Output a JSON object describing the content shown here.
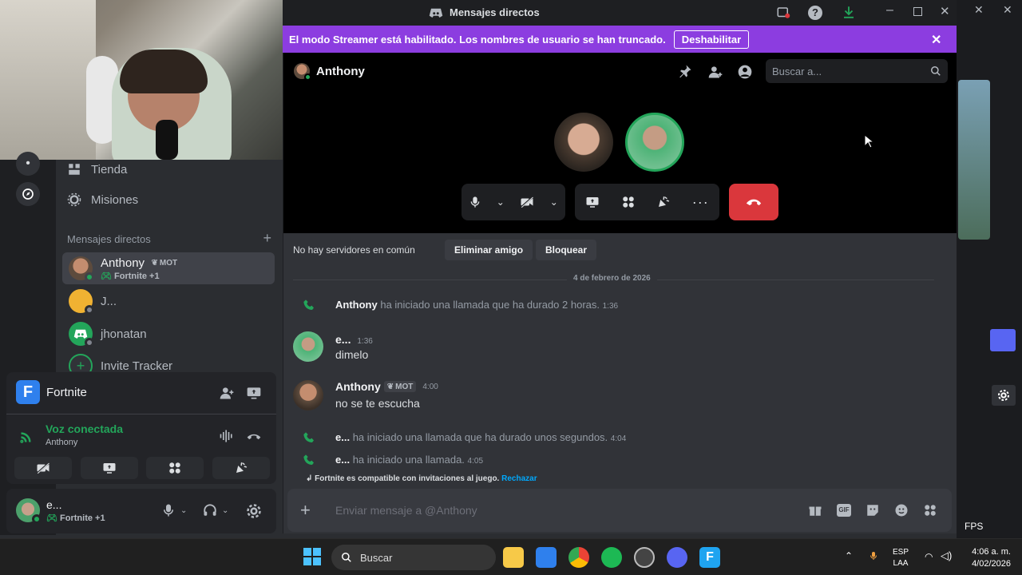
{
  "window": {
    "title": "Mensajes directos"
  },
  "streamer_banner": {
    "text": "El modo Streamer está habilitado. Los nombres de usuario se han truncado.",
    "button": "Deshabilitar"
  },
  "sidebar": {
    "nav": [
      {
        "label": "Tienda",
        "icon": "shop-icon"
      },
      {
        "label": "Misiones",
        "icon": "quests-icon"
      }
    ],
    "dm_header": "Mensajes directos",
    "dms": [
      {
        "name": "Anthony",
        "tag": "MOT",
        "activity": "Fortnite +1",
        "active": true
      },
      {
        "name": "J...",
        "activity": ""
      },
      {
        "name": "jhonatan",
        "activity": ""
      },
      {
        "name": "Invite Tracker",
        "activity": ""
      }
    ]
  },
  "voice_panel": {
    "app_name": "Fortnite",
    "status": "Voz conectada",
    "channel": "Anthony"
  },
  "user_panel": {
    "name": "e...",
    "activity": "Fortnite +1"
  },
  "header": {
    "name": "Anthony",
    "search_placeholder": "Buscar a..."
  },
  "profile_bar": {
    "no_servers": "No hay servidores en común",
    "remove_friend": "Eliminar amigo",
    "block": "Bloquear"
  },
  "chat": {
    "date_divider": "4 de febrero de 2026",
    "system1": {
      "name": "Anthony",
      "text": "ha iniciado una llamada que ha durado 2 horas.",
      "time": "1:36"
    },
    "msg1": {
      "name": "e...",
      "time": "1:36",
      "text": "dimelo"
    },
    "msg2": {
      "name": "Anthony",
      "tag": "MOT",
      "time": "4:00",
      "text": "no se te escucha"
    },
    "system2": {
      "name": "e...",
      "text": "ha iniciado una llamada que ha durado unos segundos.",
      "time": "4:04"
    },
    "system3": {
      "name": "e...",
      "text": "ha iniciado una llamada.",
      "time": "4:05"
    },
    "game_hint": "Fortnite es compatible con invitaciones al juego.",
    "game_hint_action": "Rechazar",
    "composer_placeholder": "Enviar mensaje a @Anthony"
  },
  "overlay": {
    "fps": "FPS"
  },
  "taskbar": {
    "search": "Buscar",
    "lang1": "ESP",
    "lang2": "LAA",
    "time": "4:06 a. m.",
    "date": "4/02/2026"
  },
  "colors": {
    "accent": "#8c3de0",
    "hangup": "#da373c",
    "online": "#23a55a",
    "link": "#00a8fc"
  }
}
